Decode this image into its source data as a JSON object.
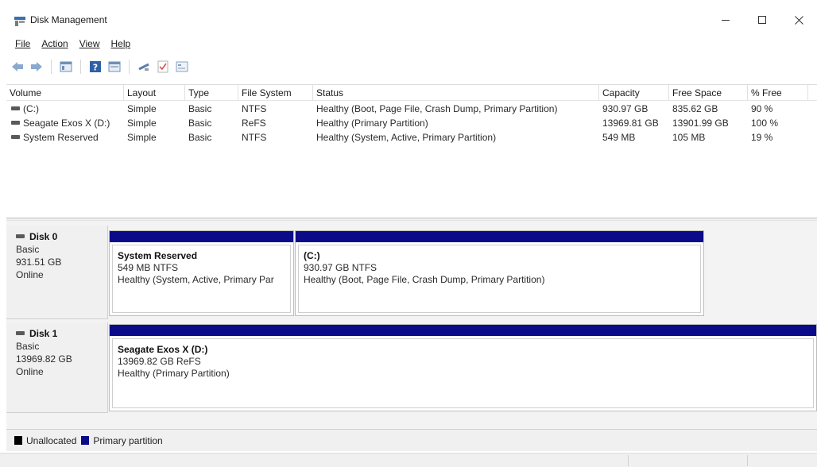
{
  "window": {
    "title": "Disk Management",
    "icon": "disk-management-icon",
    "controls": [
      "minimize",
      "maximize",
      "close"
    ]
  },
  "menu": [
    {
      "label": "File"
    },
    {
      "label": "Action"
    },
    {
      "label": "View"
    },
    {
      "label": "Help"
    }
  ],
  "toolbar": {
    "icons": [
      "back-arrow-icon",
      "forward-arrow-icon",
      "show-hide-console-tree-icon",
      "help-icon",
      "properties-icon",
      "connect-icon",
      "checklist-icon",
      "view-icon"
    ]
  },
  "volume_list": {
    "columns": [
      "Volume",
      "Layout",
      "Type",
      "File System",
      "Status",
      "Capacity",
      "Free Space",
      "% Free"
    ],
    "rows": [
      {
        "volume": "(C:)",
        "layout": "Simple",
        "type": "Basic",
        "fs": "NTFS",
        "status": "Healthy (Boot, Page File, Crash Dump, Primary Partition)",
        "capacity": "930.97 GB",
        "free": "835.62 GB",
        "pct": "90 %"
      },
      {
        "volume": "Seagate Exos X (D:)",
        "layout": "Simple",
        "type": "Basic",
        "fs": "ReFS",
        "status": "Healthy (Primary Partition)",
        "capacity": "13969.81 GB",
        "free": "13901.99 GB",
        "pct": "100 %"
      },
      {
        "volume": "System Reserved",
        "layout": "Simple",
        "type": "Basic",
        "fs": "NTFS",
        "status": "Healthy (System, Active, Primary Partition)",
        "capacity": "549 MB",
        "free": "105 MB",
        "pct": "19 %"
      }
    ]
  },
  "disks": [
    {
      "name": "Disk 0",
      "type": "Basic",
      "size": "931.51 GB",
      "state": "Online",
      "partitions": [
        {
          "name": "System Reserved",
          "size": "549 MB NTFS",
          "status": "Healthy (System, Active, Primary Par"
        },
        {
          "name": "(C:)",
          "size": "930.97 GB NTFS",
          "status": "Healthy (Boot, Page File, Crash Dump, Primary Partition)"
        }
      ]
    },
    {
      "name": "Disk 1",
      "type": "Basic",
      "size": "13969.82 GB",
      "state": "Online",
      "partitions": [
        {
          "name": "Seagate Exos X  (D:)",
          "size": "13969.82 GB ReFS",
          "status": "Healthy (Primary Partition)"
        }
      ]
    }
  ],
  "legend": [
    {
      "label": "Unallocated",
      "color": "#000000"
    },
    {
      "label": "Primary partition",
      "color": "#0b0b8a"
    }
  ]
}
